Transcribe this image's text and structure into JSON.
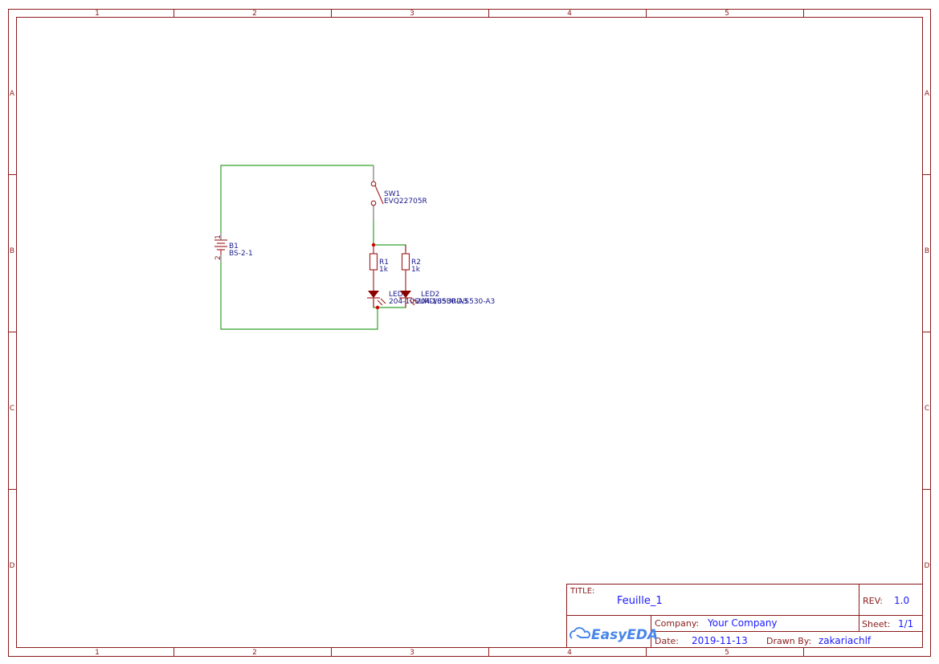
{
  "frame": {
    "columns": [
      "1",
      "2",
      "3",
      "4",
      "5"
    ],
    "rows": [
      "A",
      "B",
      "C",
      "D"
    ]
  },
  "components": {
    "b1": {
      "ref": "B1",
      "value": "BS-2-1",
      "pin1": "1",
      "pin2": "2"
    },
    "sw1": {
      "ref": "SW1",
      "value": "EVQ22705R"
    },
    "r1": {
      "ref": "R1",
      "value": "1k"
    },
    "r2": {
      "ref": "R2",
      "value": "1k"
    },
    "led1": {
      "ref": "LED1",
      "value": "204-10SURD/S530-A3"
    },
    "led2": {
      "ref": "LED2",
      "value": "204-10SURD/S530-A3"
    }
  },
  "colors": {
    "frame": "#8b1a1a",
    "wire": "#33a02c",
    "part": "#a52a2a",
    "text": "#1a1a8c",
    "junction": "#cc0000"
  },
  "title_block": {
    "title_label": "TITLE:",
    "title": "Feuille_1",
    "rev_label": "REV:",
    "rev": "1.0",
    "company_label": "Company:",
    "company": "Your Company",
    "sheet_label": "Sheet:",
    "sheet": "1/1",
    "date_label": "Date:",
    "date": "2019-11-13",
    "drawn_by_label": "Drawn By:",
    "drawn_by": "zakariachlf",
    "logo": "EasyEDA"
  }
}
